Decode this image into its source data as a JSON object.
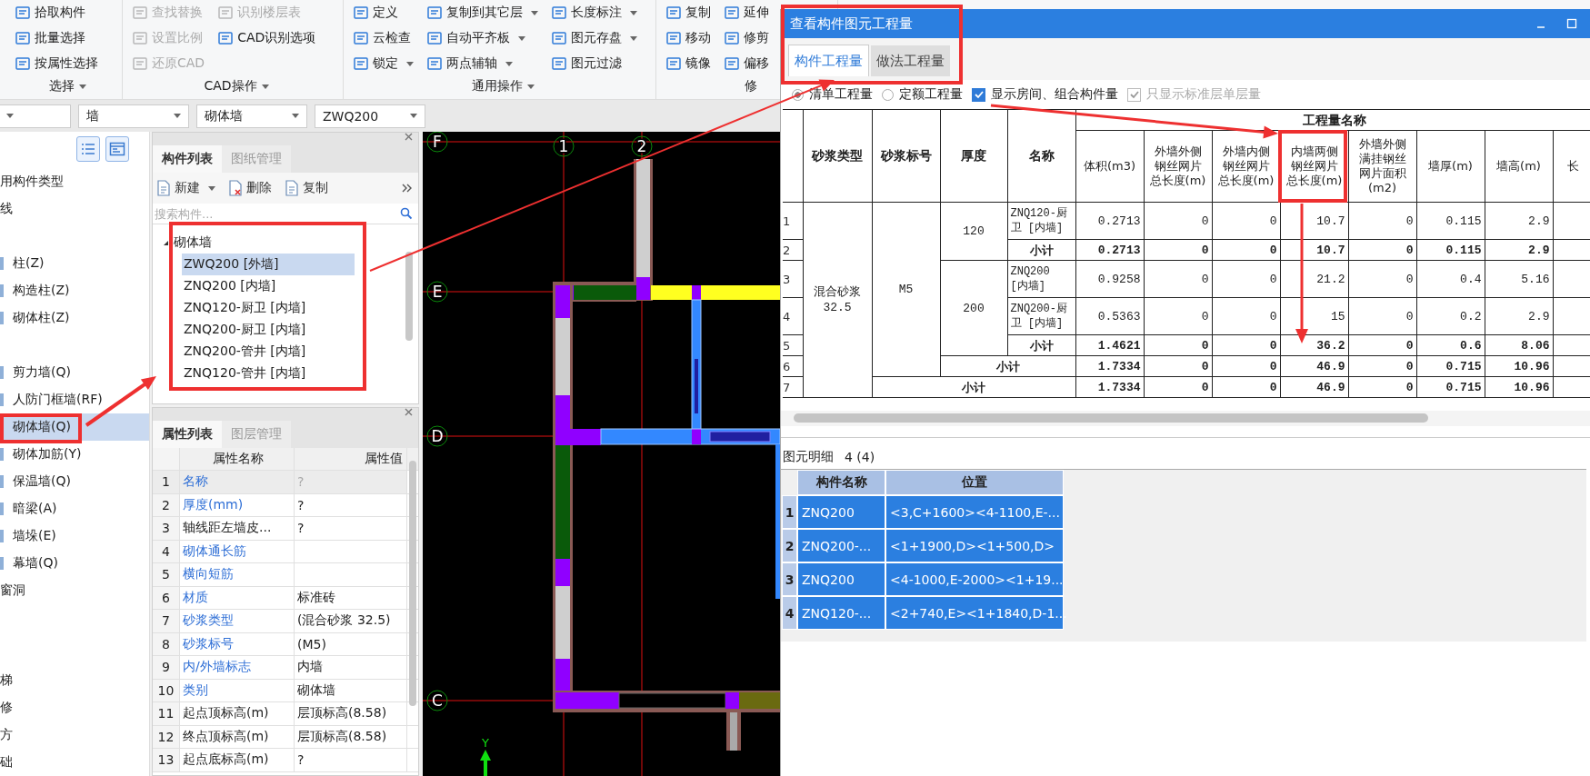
{
  "ribbon": {
    "groups": [
      {
        "label": "选择",
        "dropdown": true,
        "columns": [
          [
            {
              "label": "拾取构件",
              "disabled": false,
              "dropdown": false
            },
            {
              "label": "批量选择",
              "disabled": false,
              "dropdown": false
            },
            {
              "label": "按属性选择",
              "disabled": false,
              "dropdown": false
            }
          ]
        ]
      },
      {
        "label": "CAD操作",
        "dropdown": true,
        "columns": [
          [
            {
              "label": "查找替换",
              "disabled": true,
              "dropdown": false
            },
            {
              "label": "设置比例",
              "disabled": true,
              "dropdown": false
            },
            {
              "label": "还原CAD",
              "disabled": true,
              "dropdown": false
            }
          ],
          [
            {
              "label": "识别楼层表",
              "disabled": true,
              "dropdown": false
            },
            {
              "label": "CAD识别选项",
              "disabled": false,
              "dropdown": false
            }
          ]
        ]
      },
      {
        "label": "通用操作",
        "dropdown": true,
        "columns": [
          [
            {
              "label": "定义",
              "disabled": false,
              "dropdown": false
            },
            {
              "label": "云检查",
              "disabled": false,
              "dropdown": false
            },
            {
              "label": "锁定",
              "disabled": false,
              "dropdown": true
            }
          ],
          [
            {
              "label": "复制到其它层",
              "disabled": false,
              "dropdown": true
            },
            {
              "label": "自动平齐板",
              "disabled": false,
              "dropdown": true
            },
            {
              "label": "两点辅轴",
              "disabled": false,
              "dropdown": true
            }
          ],
          [
            {
              "label": "长度标注",
              "disabled": false,
              "dropdown": true
            },
            {
              "label": "图元存盘",
              "disabled": false,
              "dropdown": true
            },
            {
              "label": "图元过滤",
              "disabled": false,
              "dropdown": false
            }
          ]
        ]
      },
      {
        "label": "修",
        "dropdown": false,
        "columns": [
          [
            {
              "label": "复制",
              "disabled": false,
              "dropdown": false
            },
            {
              "label": "移动",
              "disabled": false,
              "dropdown": false
            },
            {
              "label": "镜像",
              "disabled": false,
              "dropdown": false
            }
          ],
          [
            {
              "label": "延伸",
              "disabled": false,
              "dropdown": false
            },
            {
              "label": "修剪",
              "disabled": false,
              "dropdown": false
            },
            {
              "label": "偏移",
              "disabled": false,
              "dropdown": false
            }
          ]
        ]
      }
    ]
  },
  "selectors": [
    {
      "kind": "dropdown"
    },
    {
      "kind": "dropdown",
      "value": "墙"
    },
    {
      "kind": "dropdown",
      "value": "砌体墙"
    },
    {
      "kind": "dropdown",
      "value": "ZWQ200"
    }
  ],
  "nav": {
    "sections": [
      {
        "label": "用构件类型"
      },
      {
        "label": "线"
      },
      {
        "children": [
          {
            "label": "柱(Z)",
            "selected": false
          },
          {
            "label": "构造柱(Z)",
            "selected": false
          },
          {
            "label": "砌体柱(Z)",
            "selected": false
          }
        ]
      },
      {
        "children": [
          {
            "label": "剪力墙(Q)",
            "selected": false
          },
          {
            "label": "人防门框墙(RF)",
            "selected": false
          },
          {
            "label": "砌体墙(Q)",
            "selected": true
          },
          {
            "label": "砌体加筋(Y)",
            "selected": false
          },
          {
            "label": "保温墙(Q)",
            "selected": false
          },
          {
            "label": "暗梁(A)",
            "selected": false
          },
          {
            "label": "墙垛(E)",
            "selected": false
          },
          {
            "label": "幕墙(Q)",
            "selected": false
          }
        ]
      },
      {
        "label": "窗洞"
      }
    ],
    "footer": [
      "梯",
      "修",
      "方",
      "础"
    ]
  },
  "component_panel": {
    "tabs": [
      {
        "label": "构件列表",
        "selected": true
      },
      {
        "label": "图纸管理",
        "selected": false
      }
    ],
    "toolbar": [
      {
        "label": "新建",
        "dropdown": true
      },
      {
        "label": "删除",
        "dropdown": false
      },
      {
        "label": "复制",
        "dropdown": false
      }
    ],
    "search": {
      "placeholder": "搜索构件..."
    },
    "tree": {
      "label": "砌体墙",
      "expanded": true,
      "children": [
        {
          "label": "ZWQ200 [外墙]",
          "selected": true
        },
        {
          "label": "ZNQ200 [内墙]",
          "selected": false
        },
        {
          "label": "ZNQ120-厨卫 [内墙]",
          "selected": false
        },
        {
          "label": "ZNQ200-厨卫 [内墙]",
          "selected": false
        },
        {
          "label": "ZNQ200-管井 [内墙]",
          "selected": false
        },
        {
          "label": "ZNQ120-管井 [内墙]",
          "selected": false
        }
      ]
    }
  },
  "property_panel": {
    "tabs": [
      {
        "label": "属性列表",
        "selected": true
      },
      {
        "label": "图层管理",
        "selected": false
      }
    ],
    "columns": [
      "属性名称",
      "属性值"
    ],
    "rows": [
      {
        "num": "1",
        "name": "名称",
        "value": "?",
        "public": true,
        "selected": true
      },
      {
        "num": "2",
        "name": "厚度(mm)",
        "value": "?",
        "public": true,
        "selected": false
      },
      {
        "num": "3",
        "name": "轴线距左墙皮...",
        "value": "?",
        "public": false,
        "selected": false
      },
      {
        "num": "4",
        "name": "砌体通长筋",
        "public": true,
        "selected": false
      },
      {
        "num": "5",
        "name": "横向短筋",
        "public": true,
        "selected": false
      },
      {
        "num": "6",
        "name": "材质",
        "value": "标准砖",
        "public": true,
        "selected": false
      },
      {
        "num": "7",
        "name": "砂浆类型",
        "value": "(混合砂浆  32.5)",
        "public": true,
        "selected": false
      },
      {
        "num": "8",
        "name": "砂浆标号",
        "value": "(M5)",
        "public": true,
        "selected": false
      },
      {
        "num": "9",
        "name": "内/外墙标志",
        "value": "内墙",
        "public": true,
        "selected": false
      },
      {
        "num": "10",
        "name": "类别",
        "value": "砌体墙",
        "public": true,
        "selected": false
      },
      {
        "num": "11",
        "name": "起点顶标高(m)",
        "value": "层顶标高(8.58)",
        "public": false,
        "selected": false
      },
      {
        "num": "12",
        "name": "终点顶标高(m)",
        "value": "层顶标高(8.58)",
        "public": false,
        "selected": false
      },
      {
        "num": "13",
        "name": "起点底标高(m)",
        "value": "?",
        "public": false,
        "selected": false
      }
    ]
  },
  "canvas": {
    "row_axes": [
      "F",
      "E",
      "D",
      "C"
    ],
    "column_axes": [
      "1",
      "2"
    ],
    "y_axis_label": "Y"
  },
  "dialog": {
    "title": "查看构件图元工程量",
    "tabs": [
      {
        "label": "构件工程量",
        "selected": true
      },
      {
        "label": "做法工程量",
        "selected": false
      }
    ],
    "options": [
      {
        "kind": "radio",
        "label": "清单工程量",
        "checked": true,
        "disabled": false
      },
      {
        "kind": "radio",
        "label": "定额工程量",
        "checked": false,
        "disabled": false
      },
      {
        "kind": "checkbox",
        "label": "显示房间、组合构件量",
        "checked": true,
        "disabled": false
      },
      {
        "kind": "checkbox",
        "label": "只显示标准层单层量",
        "checked": true,
        "disabled": true
      }
    ],
    "table": {
      "key_columns": [
        "砂浆类型",
        "砂浆标号",
        "厚度",
        "名称"
      ],
      "group_header": "工程量名称",
      "value_columns": [
        "体积(m3)",
        "外墙外侧钢丝网片总长度(m)",
        "外墙内侧钢丝网片总长度(m)",
        "内墙两侧钢丝网片总长度(m)",
        "外墙外侧满挂钢丝网片面积(m2)",
        "墙厚(m)",
        "墙高(m)",
        "长"
      ],
      "types": [
        {
          "label": "混合砂浆 32.5",
          "grades": [
            {
              "label": "M5",
              "thicknesses": [
                {
                  "label": "120",
                  "rows": [
                    {
                      "num": "1",
                      "name": "ZNQ120-厨卫 [内墙]",
                      "values": [
                        "0.2713",
                        "0",
                        "0",
                        "10.7",
                        "0",
                        "0.115",
                        "2.9"
                      ]
                    }
                  ],
                  "subtotal": {
                    "num": "2",
                    "label": "小计",
                    "values": [
                      "0.2713",
                      "0",
                      "0",
                      "10.7",
                      "0",
                      "0.115",
                      "2.9"
                    ]
                  }
                },
                {
                  "label": "200",
                  "rows": [
                    {
                      "num": "3",
                      "name": "ZNQ200 [内墙]",
                      "values": [
                        "0.9258",
                        "0",
                        "0",
                        "21.2",
                        "0",
                        "0.4",
                        "5.16"
                      ]
                    },
                    {
                      "num": "4",
                      "name": "ZNQ200-厨卫 [内墙]",
                      "values": [
                        "0.5363",
                        "0",
                        "0",
                        "15",
                        "0",
                        "0.2",
                        "2.9"
                      ]
                    }
                  ],
                  "subtotal": {
                    "num": "5",
                    "label": "小计",
                    "values": [
                      "1.4621",
                      "0",
                      "0",
                      "36.2",
                      "0",
                      "0.6",
                      "8.06"
                    ]
                  }
                }
              ],
              "subtotal": {
                "num": "6",
                "label": "小计",
                "values": [
                  "1.7334",
                  "0",
                  "0",
                  "46.9",
                  "0",
                  "0.715",
                  "10.96"
                ]
              }
            }
          ],
          "subtotal": {
            "num": "7",
            "label": "小计",
            "values": [
              "1.7334",
              "0",
              "0",
              "46.9",
              "0",
              "0.715",
              "10.96"
            ]
          }
        }
      ]
    },
    "detail": {
      "title": "图元明细",
      "count": "4 (4)",
      "columns": [
        "构件名称",
        "位置"
      ],
      "rows": [
        {
          "num": "1",
          "name": "ZNQ200",
          "position": "<3,C+1600><4-1100,E-...",
          "selected": true
        },
        {
          "num": "2",
          "name": "ZNQ200-...",
          "position": "<1+1900,D><1+500,D>",
          "selected": true
        },
        {
          "num": "3",
          "name": "ZNQ200",
          "position": "<4-1000,E-2000><1+19...",
          "selected": true
        },
        {
          "num": "4",
          "name": "ZNQ120-...",
          "position": "<2+740,E><1+1840,D-1...",
          "selected": true
        }
      ]
    }
  }
}
